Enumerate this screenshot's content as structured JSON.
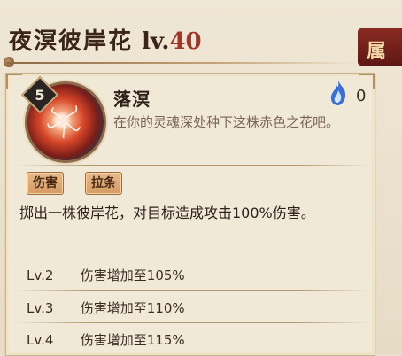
{
  "header": {
    "hero_name": "夜溟彼岸花",
    "level_label": "lv.",
    "level_value": "40",
    "side_tab_glyph": "属"
  },
  "skill": {
    "cost": "5",
    "name": "落溟",
    "quote": "在你的灵魂深处种下这株赤色之花吧。",
    "fire_count": "0",
    "tags": [
      "伤害",
      "拉条"
    ],
    "description": "掷出一株彼岸花，对目标造成攻击100%伤害。",
    "levels": [
      {
        "level": "Lv.2",
        "effect": "伤害增加至105%"
      },
      {
        "level": "Lv.3",
        "effect": "伤害增加至110%"
      },
      {
        "level": "Lv.4",
        "effect": "伤害增加至115%"
      }
    ]
  },
  "colors": {
    "accent_level": "#a3342a",
    "tag_bg": "#d49a62",
    "fire_blue": "#3b6fd8"
  }
}
